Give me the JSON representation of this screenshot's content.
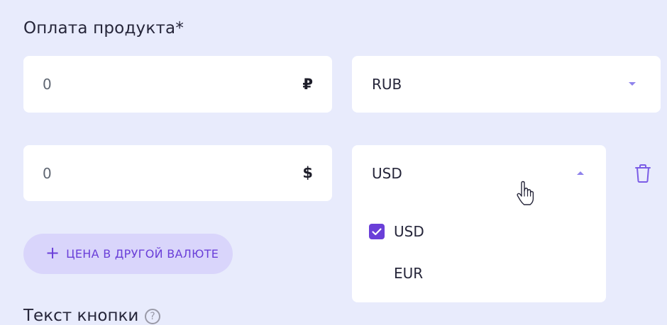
{
  "section": {
    "title": "Оплата продукта*"
  },
  "price_rows": [
    {
      "amount_value": "0",
      "currency_symbol": "₽",
      "currency_code": "RUB",
      "dropdown_state": "collapsed"
    },
    {
      "amount_value": "0",
      "currency_symbol": "$",
      "currency_code": "USD",
      "dropdown_state": "expanded",
      "delete_icon": "trash-icon"
    }
  ],
  "dropdown": {
    "options": [
      {
        "label": "USD",
        "checked": true
      },
      {
        "label": "EUR",
        "checked": false
      }
    ]
  },
  "add_currency": {
    "icon": "plus",
    "label": "ЦЕНА В ДРУГОЙ ВАЛЮТЕ"
  },
  "next_section": {
    "label": "Текст кнопки",
    "help_icon": "?"
  },
  "colors": {
    "background": "#e8ebfc",
    "accent": "#6a3fd8",
    "caret": "#8f83ec",
    "pill_background": "#d9d5fb",
    "field_background": "#ffffff"
  }
}
